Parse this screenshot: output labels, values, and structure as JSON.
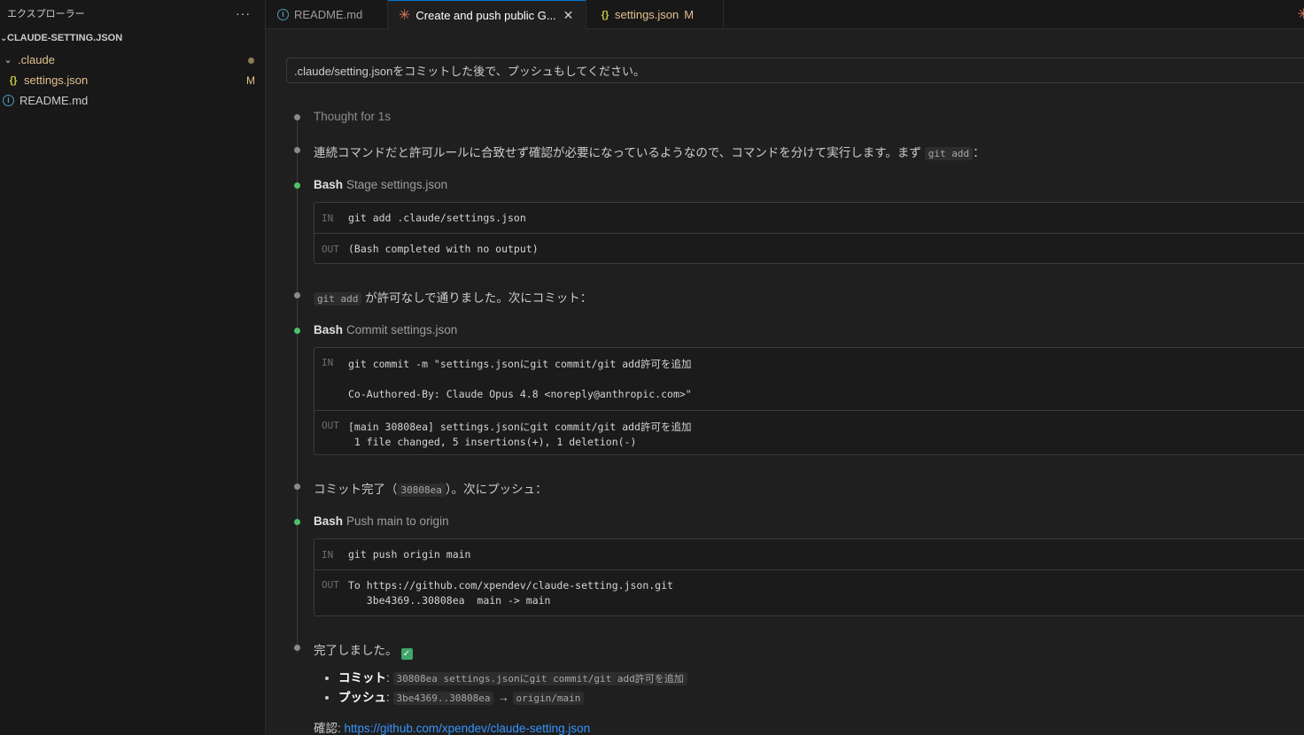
{
  "sidebar": {
    "title": "エクスプローラー",
    "more": "···",
    "section": "CLAUDE-SETTING.JSON",
    "folder": ".claude",
    "file_settings": "settings.json",
    "file_settings_status": "M",
    "file_readme": "README.md"
  },
  "tabs": [
    {
      "label": "README.md"
    },
    {
      "label": "Create and push public G...",
      "close": "✕"
    },
    {
      "label": "settings.json",
      "flag": "M"
    }
  ],
  "prompt": ".claude/setting.jsonをコミットした後で、プッシュもしてください。",
  "messages": {
    "thought": "Thought for 1s",
    "m1_text": "連続コマンドだと許可ルールに合致せず確認が必要になっているようなので、コマンドを分けて実行します。まず",
    "m1_code": "git add",
    "m1_tail": "：",
    "bash1": {
      "label": "Bash",
      "desc": "Stage settings.json",
      "in": "git add .claude/settings.json",
      "out": "(Bash completed with no output)"
    },
    "m2_code": "git add",
    "m2_text": "が許可なしで通りました。次にコミット：",
    "bash2": {
      "label": "Bash",
      "desc": "Commit settings.json",
      "in1": "git commit -m \"settings.jsonにgit commit/git add許可を追加",
      "in2": "Co-Authored-By: Claude Opus 4.8 <noreply@anthropic.com>\"",
      "out1": "[main 30808ea] settings.jsonにgit commit/git add許可を追加",
      "out2": " 1 file changed, 5 insertions(+), 1 deletion(-)"
    },
    "m3_text": "コミット完了（",
    "m3_code": "30808ea",
    "m3_tail": "）。次にプッシュ：",
    "bash3": {
      "label": "Bash",
      "desc": "Push main to origin",
      "in": "git push origin main",
      "out1": "To https://github.com/xpendev/claude-setting.json.git",
      "out2": "   3be4369..30808ea  main -> main"
    },
    "done": "完了しました。",
    "commit_label": "コミット",
    "commit_code": "30808ea settings.jsonにgit commit/git add許可を追加",
    "push_label": "プッシュ",
    "push_from": "3be4369..30808ea",
    "push_arrow": "→",
    "push_to": "origin/main",
    "confirm_label": "確認:",
    "confirm_link": "https://github.com/xpendev/claude-setting.json"
  },
  "io_labels": {
    "in": "IN",
    "out": "OUT"
  },
  "colors": {
    "accent_star": "#d97757",
    "link": "#3794ff",
    "modified": "#e2c08d",
    "success": "#4ec26a"
  }
}
